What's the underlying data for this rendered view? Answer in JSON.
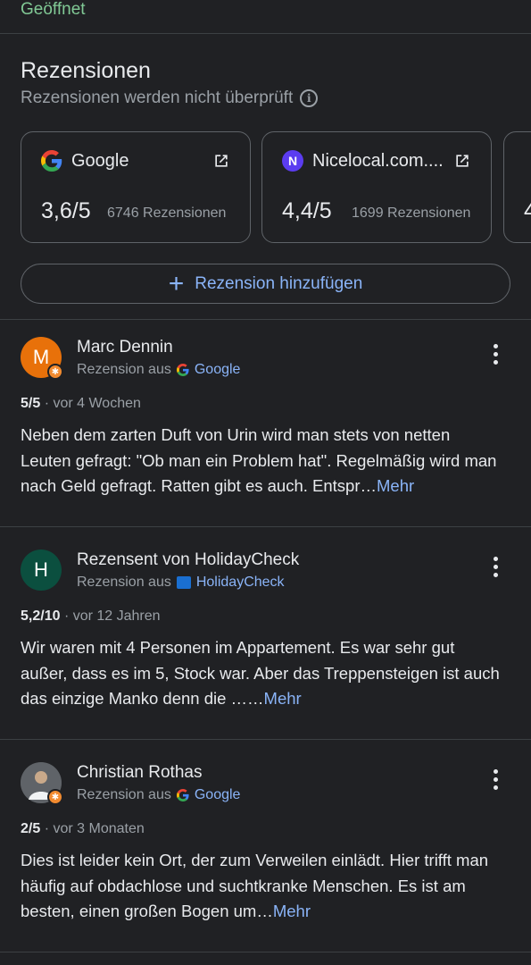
{
  "status": "Geöffnet",
  "section": {
    "title": "Rezensionen",
    "subtitle": "Rezensionen werden nicht überprüft"
  },
  "sources": [
    {
      "name": "Google",
      "score": "3,6/5",
      "count": "6746 Rezensionen"
    },
    {
      "name": "Nicelocal.com....",
      "score": "4,4/5",
      "count": "1699 Rezensionen"
    },
    {
      "name": "",
      "score": "4",
      "count": ""
    }
  ],
  "add_review_label": "Rezension hinzufügen",
  "reviews": [
    {
      "author": "Marc Dennin",
      "avatar_letter": "M",
      "avatar_color": "#e8710a",
      "source_prefix": "Rezension aus",
      "source": "Google",
      "rating": "5/5",
      "time": "· vor 4 Wochen",
      "text": "Neben dem zarten Duft von Urin wird man stets von netten Leuten gefragt: \"Ob man ein Problem hat\". Regelmäßig wird man nach Geld gefragt. Ratten gibt es auch. Entspr…",
      "more": "Mehr"
    },
    {
      "author": "Rezensent von HolidayCheck",
      "avatar_letter": "H",
      "avatar_color": "#0b4f3f",
      "source_prefix": "Rezension aus",
      "source": "HolidayCheck",
      "rating": "5,2/10",
      "time": "· vor 12 Jahren",
      "text": "Wir waren mit 4 Personen im Appartement. Es war sehr gut außer, dass es im 5, Stock war. Aber das Treppensteigen ist auch das einzige Manko denn die ……",
      "more": "Mehr"
    },
    {
      "author": "Christian Rothas",
      "avatar_letter": "",
      "avatar_color": "#3c4043",
      "source_prefix": "Rezension aus",
      "source": "Google",
      "rating": "2/5",
      "time": "· vor 3 Monaten",
      "text": "Dies ist leider kein Ort, der zum Verweilen einlädt. Hier trifft man häufig auf obdachlose und suchtkranke Menschen. Es ist am besten, einen großen Bogen um…",
      "more": "Mehr"
    }
  ]
}
